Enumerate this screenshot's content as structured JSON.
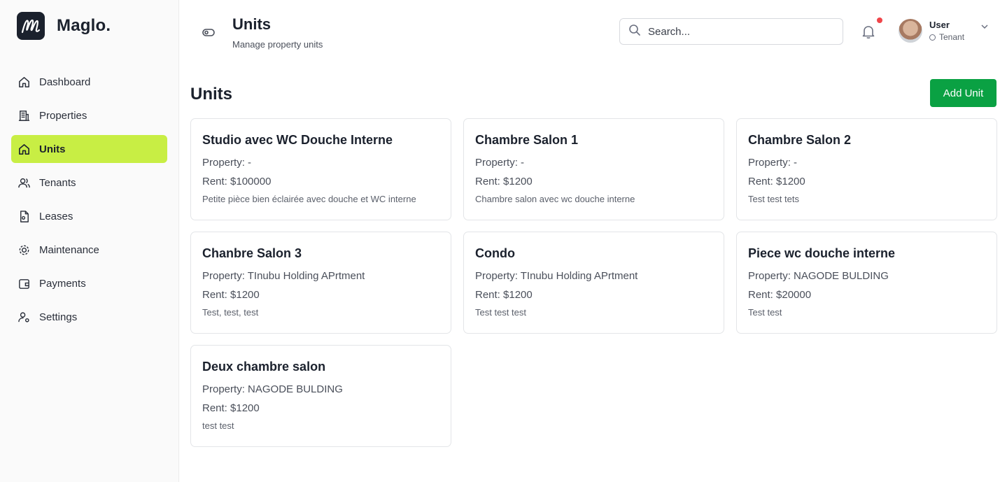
{
  "brand": {
    "name": "Maglo."
  },
  "sidebar": {
    "items": [
      {
        "label": "Dashboard",
        "icon": "home-icon",
        "active": false
      },
      {
        "label": "Properties",
        "icon": "building-icon",
        "active": false
      },
      {
        "label": "Units",
        "icon": "home-icon",
        "active": true
      },
      {
        "label": "Tenants",
        "icon": "users-icon",
        "active": false
      },
      {
        "label": "Leases",
        "icon": "file-icon",
        "active": false
      },
      {
        "label": "Maintenance",
        "icon": "cog-icon",
        "active": false
      },
      {
        "label": "Payments",
        "icon": "wallet-icon",
        "active": false
      },
      {
        "label": "Settings",
        "icon": "user-settings-icon",
        "active": false
      }
    ]
  },
  "header": {
    "title": "Units",
    "subtitle": "Manage property units",
    "search_placeholder": "Search...",
    "user": {
      "name": "User",
      "role": "Tenant"
    }
  },
  "main": {
    "title": "Units",
    "add_button": "Add Unit",
    "units": [
      {
        "name": "Studio avec WC Douche Interne",
        "property": "Property: -",
        "rent": "Rent: $100000",
        "description": "Petite pièce bien éclairée avec douche et WC interne"
      },
      {
        "name": "Chambre Salon 1",
        "property": "Property: -",
        "rent": "Rent: $1200",
        "description": "Chambre salon avec wc douche interne"
      },
      {
        "name": "Chambre Salon 2",
        "property": "Property: -",
        "rent": "Rent: $1200",
        "description": "Test test tets"
      },
      {
        "name": "Chanbre Salon 3",
        "property": "Property: TInubu Holding APrtment",
        "rent": "Rent: $1200",
        "description": "Test, test, test"
      },
      {
        "name": "Condo",
        "property": "Property: TInubu Holding APrtment",
        "rent": "Rent: $1200",
        "description": "Test test test"
      },
      {
        "name": "Piece wc douche interne",
        "property": "Property: NAGODE BULDING",
        "rent": "Rent: $20000",
        "description": "Test test"
      },
      {
        "name": "Deux chambre salon",
        "property": "Property: NAGODE BULDING",
        "rent": "Rent: $1200",
        "description": "test test"
      }
    ]
  },
  "colors": {
    "accent": "#c8ee44",
    "primary_button": "#0aa143",
    "notification": "#f0454a"
  }
}
